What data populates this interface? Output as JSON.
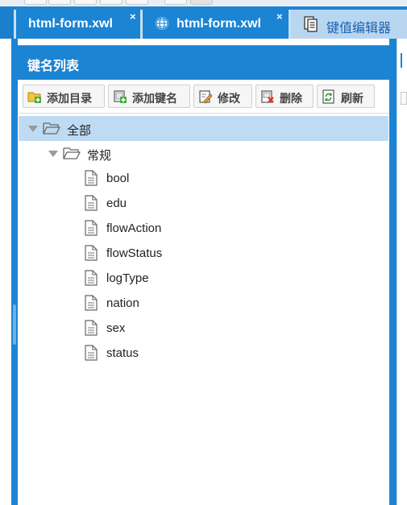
{
  "tabs": [
    {
      "label": "html-form.xwl",
      "close": "×"
    },
    {
      "label": "html-form.xwl",
      "close": "×"
    },
    {
      "label": "键值编辑器"
    }
  ],
  "panel": {
    "title": "键名列表",
    "toolbar": {
      "add_dir": "添加目录",
      "add_key": "添加键名",
      "edit": "修改",
      "delete": "删除",
      "refresh": "刷新"
    }
  },
  "tree": {
    "root": "全部",
    "group": "常规",
    "items": [
      "bool",
      "edu",
      "flowAction",
      "flowStatus",
      "logType",
      "nation",
      "sex",
      "status"
    ]
  },
  "colors": {
    "accent": "#1b84d3",
    "selected_row": "#bedbf3",
    "active_tab": "#b9d6f1"
  }
}
